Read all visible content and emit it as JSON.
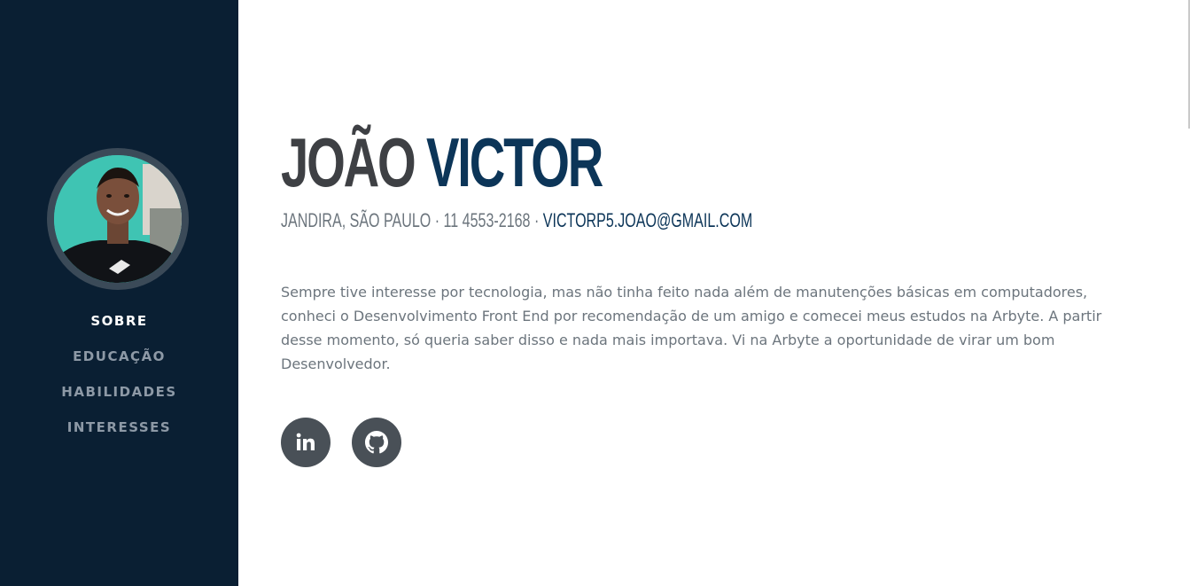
{
  "nav": {
    "items": [
      {
        "label": "SOBRE",
        "active": true
      },
      {
        "label": "EDUCAÇÃO",
        "active": false
      },
      {
        "label": "HABILIDADES",
        "active": false
      },
      {
        "label": "INTERESSES",
        "active": false
      }
    ]
  },
  "profile": {
    "first_name": "JOÃO",
    "last_name": "VICTOR",
    "location": "JANDIRA, SÃO PAULO",
    "separator": " · ",
    "phone": "11 4553-2168",
    "email": "VICTORP5.JOAO@GMAIL.COM",
    "bio": "Sempre tive interesse por tecnologia, mas não tinha feito nada além de manutenções básicas em computadores, conheci o Desenvolvimento Front End por recomendação de um amigo e comecei meus estudos na Arbyte. A partir desse momento, só queria saber disso e nada mais importava. Vi na Arbyte a oportunidade de virar um bom Desenvolvedor."
  },
  "social": [
    {
      "name": "linkedin-icon"
    },
    {
      "name": "github-icon"
    }
  ],
  "colors": {
    "sidebar_bg": "#0a1f33",
    "accent": "#0c3558",
    "name_dark": "#3e4044",
    "text_muted": "#6c757d",
    "social_bg": "#495057",
    "nav_inactive": "#8d99a6"
  }
}
